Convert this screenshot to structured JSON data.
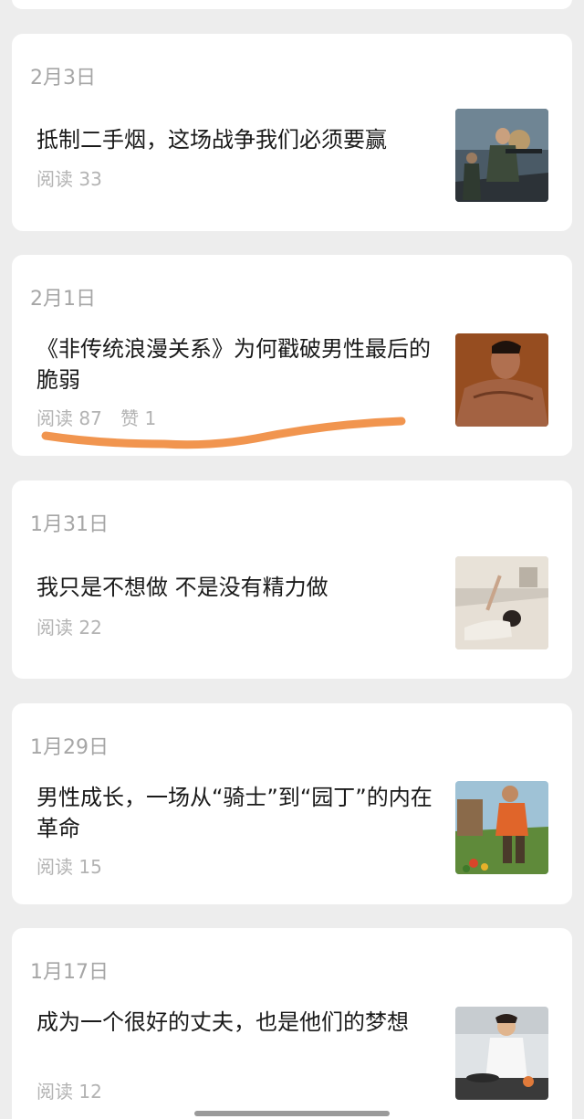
{
  "articles": [
    {
      "date": "2月3日",
      "title": "抵制二手烟，这场战争我们必须要赢",
      "reads": "阅读 33",
      "likes": "",
      "thumbnail_icon": "soldiers-battle-image"
    },
    {
      "date": "2月1日",
      "title": "《非传统浪漫关系》为何戳破男性最后的脆弱",
      "reads": "阅读 87",
      "likes": "赞 1",
      "thumbnail_icon": "man-portrait-image"
    },
    {
      "date": "1月31日",
      "title": "我只是不想做 不是没有精力做",
      "reads": "阅读 22",
      "likes": "",
      "thumbnail_icon": "woman-lying-bed-image"
    },
    {
      "date": "1月29日",
      "title": "男性成长，一场从“骑士”到“园丁”的内在革命",
      "reads": "阅读 15",
      "likes": "",
      "thumbnail_icon": "man-gardening-image"
    },
    {
      "date": "1月17日",
      "title": "成为一个很好的丈夫，也是他们的梦想",
      "reads": "阅读 12",
      "likes": "",
      "thumbnail_icon": "man-cooking-image"
    }
  ],
  "colors": {
    "background": "#ededed",
    "card": "#ffffff",
    "date_text": "#a6a6a6",
    "title_text": "#1a1a1a",
    "meta_text": "#b3b3b3",
    "annotation_stroke": "#f08a3c"
  }
}
